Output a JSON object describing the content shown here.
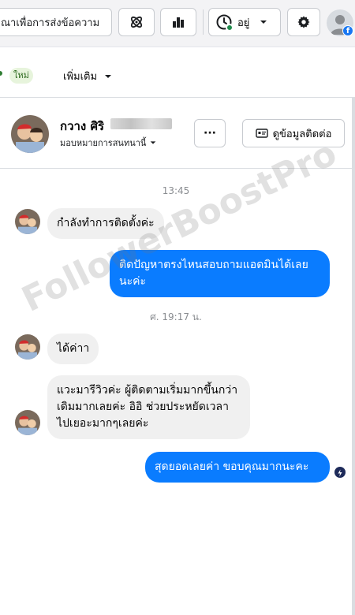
{
  "toolbar": {
    "template_button_label": "ณาเพื่อการส่งข้อความ",
    "status_label": "อยู่",
    "status_color": "#1f8b4c"
  },
  "tabs": {
    "new_badge": "ใหม่",
    "more_label": "เพิ่มเติม"
  },
  "conversation": {
    "name": "กวาง ศิริ",
    "assign_label": "มอบหมายการสนทนานี้",
    "more_button": "···",
    "contact_button": "ดูข้อมูลติดต่อ"
  },
  "messages": {
    "time1": "13:45",
    "m1": "กำลังทำการติดตั้งค่ะ",
    "m2": "ติดปัญหาตรงไหนสอบถามแอดมินได้เลยนะค่ะ",
    "time2": "ศ. 19:17 น.",
    "m3": "ได้ค่าา",
    "m4": "แวะมารีวิวค่ะ ผู้ติดตามเริ่มมากขึ้นกว่าเดิมมากเลยค่ะ อิอิ ช่วยประหยัดเวลาไปเยอะมากๆเลยค่ะ",
    "m5": "สุดยอดเลยค่า ขอบคุณมากนะคะ"
  },
  "watermark": "FollowerBoostPro",
  "colors": {
    "outgoing": "#0a7cff",
    "incoming": "#f0f0f0",
    "brand": "#1877f2"
  }
}
